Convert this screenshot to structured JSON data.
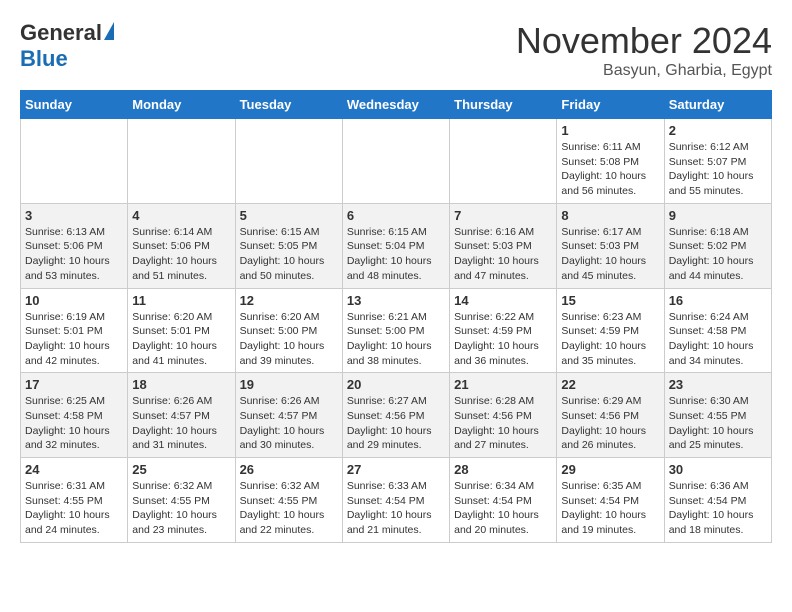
{
  "header": {
    "logo_general": "General",
    "logo_blue": "Blue",
    "month_title": "November 2024",
    "subtitle": "Basyun, Gharbia, Egypt"
  },
  "calendar": {
    "weekdays": [
      "Sunday",
      "Monday",
      "Tuesday",
      "Wednesday",
      "Thursday",
      "Friday",
      "Saturday"
    ],
    "weeks": [
      [
        {
          "day": "",
          "info": ""
        },
        {
          "day": "",
          "info": ""
        },
        {
          "day": "",
          "info": ""
        },
        {
          "day": "",
          "info": ""
        },
        {
          "day": "",
          "info": ""
        },
        {
          "day": "1",
          "info": "Sunrise: 6:11 AM\nSunset: 5:08 PM\nDaylight: 10 hours\nand 56 minutes."
        },
        {
          "day": "2",
          "info": "Sunrise: 6:12 AM\nSunset: 5:07 PM\nDaylight: 10 hours\nand 55 minutes."
        }
      ],
      [
        {
          "day": "3",
          "info": "Sunrise: 6:13 AM\nSunset: 5:06 PM\nDaylight: 10 hours\nand 53 minutes."
        },
        {
          "day": "4",
          "info": "Sunrise: 6:14 AM\nSunset: 5:06 PM\nDaylight: 10 hours\nand 51 minutes."
        },
        {
          "day": "5",
          "info": "Sunrise: 6:15 AM\nSunset: 5:05 PM\nDaylight: 10 hours\nand 50 minutes."
        },
        {
          "day": "6",
          "info": "Sunrise: 6:15 AM\nSunset: 5:04 PM\nDaylight: 10 hours\nand 48 minutes."
        },
        {
          "day": "7",
          "info": "Sunrise: 6:16 AM\nSunset: 5:03 PM\nDaylight: 10 hours\nand 47 minutes."
        },
        {
          "day": "8",
          "info": "Sunrise: 6:17 AM\nSunset: 5:03 PM\nDaylight: 10 hours\nand 45 minutes."
        },
        {
          "day": "9",
          "info": "Sunrise: 6:18 AM\nSunset: 5:02 PM\nDaylight: 10 hours\nand 44 minutes."
        }
      ],
      [
        {
          "day": "10",
          "info": "Sunrise: 6:19 AM\nSunset: 5:01 PM\nDaylight: 10 hours\nand 42 minutes."
        },
        {
          "day": "11",
          "info": "Sunrise: 6:20 AM\nSunset: 5:01 PM\nDaylight: 10 hours\nand 41 minutes."
        },
        {
          "day": "12",
          "info": "Sunrise: 6:20 AM\nSunset: 5:00 PM\nDaylight: 10 hours\nand 39 minutes."
        },
        {
          "day": "13",
          "info": "Sunrise: 6:21 AM\nSunset: 5:00 PM\nDaylight: 10 hours\nand 38 minutes."
        },
        {
          "day": "14",
          "info": "Sunrise: 6:22 AM\nSunset: 4:59 PM\nDaylight: 10 hours\nand 36 minutes."
        },
        {
          "day": "15",
          "info": "Sunrise: 6:23 AM\nSunset: 4:59 PM\nDaylight: 10 hours\nand 35 minutes."
        },
        {
          "day": "16",
          "info": "Sunrise: 6:24 AM\nSunset: 4:58 PM\nDaylight: 10 hours\nand 34 minutes."
        }
      ],
      [
        {
          "day": "17",
          "info": "Sunrise: 6:25 AM\nSunset: 4:58 PM\nDaylight: 10 hours\nand 32 minutes."
        },
        {
          "day": "18",
          "info": "Sunrise: 6:26 AM\nSunset: 4:57 PM\nDaylight: 10 hours\nand 31 minutes."
        },
        {
          "day": "19",
          "info": "Sunrise: 6:26 AM\nSunset: 4:57 PM\nDaylight: 10 hours\nand 30 minutes."
        },
        {
          "day": "20",
          "info": "Sunrise: 6:27 AM\nSunset: 4:56 PM\nDaylight: 10 hours\nand 29 minutes."
        },
        {
          "day": "21",
          "info": "Sunrise: 6:28 AM\nSunset: 4:56 PM\nDaylight: 10 hours\nand 27 minutes."
        },
        {
          "day": "22",
          "info": "Sunrise: 6:29 AM\nSunset: 4:56 PM\nDaylight: 10 hours\nand 26 minutes."
        },
        {
          "day": "23",
          "info": "Sunrise: 6:30 AM\nSunset: 4:55 PM\nDaylight: 10 hours\nand 25 minutes."
        }
      ],
      [
        {
          "day": "24",
          "info": "Sunrise: 6:31 AM\nSunset: 4:55 PM\nDaylight: 10 hours\nand 24 minutes."
        },
        {
          "day": "25",
          "info": "Sunrise: 6:32 AM\nSunset: 4:55 PM\nDaylight: 10 hours\nand 23 minutes."
        },
        {
          "day": "26",
          "info": "Sunrise: 6:32 AM\nSunset: 4:55 PM\nDaylight: 10 hours\nand 22 minutes."
        },
        {
          "day": "27",
          "info": "Sunrise: 6:33 AM\nSunset: 4:54 PM\nDaylight: 10 hours\nand 21 minutes."
        },
        {
          "day": "28",
          "info": "Sunrise: 6:34 AM\nSunset: 4:54 PM\nDaylight: 10 hours\nand 20 minutes."
        },
        {
          "day": "29",
          "info": "Sunrise: 6:35 AM\nSunset: 4:54 PM\nDaylight: 10 hours\nand 19 minutes."
        },
        {
          "day": "30",
          "info": "Sunrise: 6:36 AM\nSunset: 4:54 PM\nDaylight: 10 hours\nand 18 minutes."
        }
      ]
    ]
  }
}
